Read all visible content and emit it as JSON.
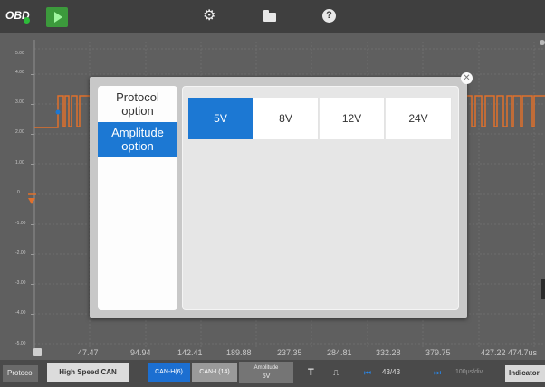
{
  "topbar": {
    "obd_label": "OBD",
    "run_icon": "play-icon",
    "settings_icon": "gear-icon",
    "folder_icon": "folder-icon",
    "help_icon": "help-icon"
  },
  "plot": {
    "y_ticks": [
      "5.00",
      "4.00",
      "3.00",
      "2.00",
      "1.00",
      "0",
      "-1.00",
      "-2.00",
      "-3.00",
      "-4.00",
      "-5.00"
    ],
    "x_ticks": [
      "47.47",
      "94.94",
      "142.41",
      "189.88",
      "237.35",
      "284.81",
      "332.28",
      "379.75",
      "427.22",
      "474.7us"
    ],
    "signal_color": "#e0702c",
    "marker_color": "#1c78d3"
  },
  "dialog": {
    "side_items": [
      {
        "label": "Protocol\noption"
      },
      {
        "label": "Amplitude\noption"
      }
    ],
    "amplitude_options": [
      "5V",
      "8V",
      "12V",
      "24V"
    ],
    "selected_option": "5V",
    "close_icon": "close-icon"
  },
  "bottombar": {
    "protocol_label": "Protocol",
    "protocol_value": "High Speed CAN",
    "can_high": "CAN-H(6)",
    "can_low": "CAN-L(14)",
    "amplitude_label": "Amplitude",
    "amplitude_value": "5V",
    "trigger_icon": "T",
    "pulse_icon": "⎍",
    "frame_count": "43/43",
    "time_div": "100μs/div",
    "indicator_label": "Indicator"
  }
}
